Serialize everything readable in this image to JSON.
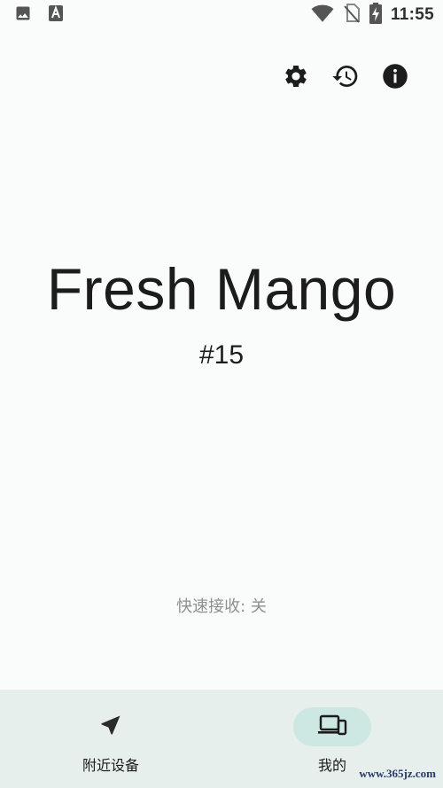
{
  "status_bar": {
    "time": "11:55",
    "left_icons": [
      "image-icon",
      "font-a-icon"
    ],
    "right_icons": [
      "wifi-icon",
      "no-sim-icon",
      "battery-charging-icon"
    ]
  },
  "top_actions": [
    {
      "name": "settings-icon"
    },
    {
      "name": "history-icon"
    },
    {
      "name": "info-icon"
    }
  ],
  "main": {
    "device_name": "Fresh Mango",
    "device_number": "#15",
    "quick_receive": "快速接收: 关"
  },
  "bottom_nav": {
    "items": [
      {
        "label": "附近设备",
        "icon": "navigation-arrow-icon",
        "active": false
      },
      {
        "label": "我的",
        "icon": "devices-icon",
        "active": true
      }
    ]
  },
  "watermark": "www.365jz.com",
  "colors": {
    "background": "#fafcfb",
    "nav_background": "#e6efec",
    "nav_active_pill": "#cde7e2",
    "text_primary": "#1c1c1c",
    "text_secondary": "#8f8f8f"
  }
}
